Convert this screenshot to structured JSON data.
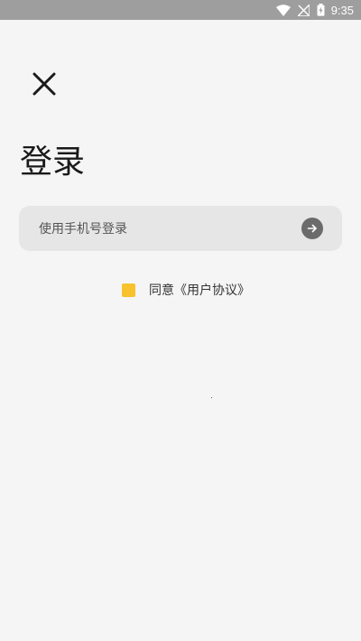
{
  "status_bar": {
    "time": "9:35",
    "icons": [
      "wifi-icon",
      "no-signal-icon",
      "battery-charging-icon"
    ]
  },
  "header": {
    "close_icon": "close-icon",
    "title": "登录"
  },
  "phone_login": {
    "label": "使用手机号登录",
    "arrow_icon": "arrow-right-icon"
  },
  "agreement": {
    "text": "同意《用户协议》",
    "checkbox_color": "#f7c22d"
  },
  "colors": {
    "background": "#f5f5f5",
    "status_bar": "#9e9e9e",
    "input_background": "#e6e6e6",
    "arrow_button": "#6b6b6b",
    "accent": "#f7c22d"
  }
}
